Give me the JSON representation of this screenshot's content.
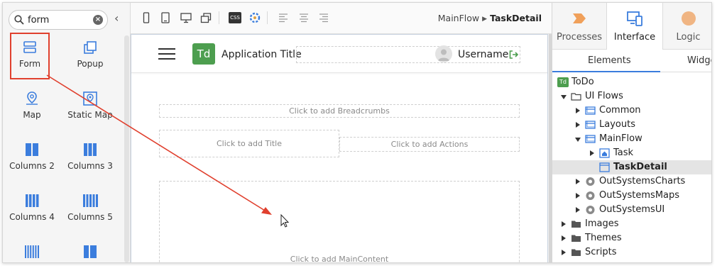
{
  "toolbox": {
    "search_value": "form",
    "items": [
      {
        "label": "Form",
        "icon": "form-icon",
        "selected": true
      },
      {
        "label": "Popup",
        "icon": "popup-icon"
      },
      {
        "label": "Map",
        "icon": "map-pin-icon"
      },
      {
        "label": "Static Map",
        "icon": "static-map-icon"
      },
      {
        "label": "Columns 2",
        "icon": "columns-2-icon"
      },
      {
        "label": "Columns 3",
        "icon": "columns-3-icon"
      },
      {
        "label": "Columns 4",
        "icon": "columns-4-icon"
      },
      {
        "label": "Columns 5",
        "icon": "columns-5-icon"
      }
    ]
  },
  "toolbar": {
    "css_label": "CSS",
    "breadcrumb_parent": "MainFlow",
    "breadcrumb_current": "TaskDetail"
  },
  "canvas": {
    "logo_text": "Td",
    "app_title": "Application Title",
    "username": "Username",
    "breadcrumbs_placeholder": "Click to add Breadcrumbs",
    "title_placeholder": "Click to add Title",
    "actions_placeholder": "Click to add Actions",
    "maincontent_placeholder": "Click to add MainContent"
  },
  "right_panel": {
    "tabs": [
      {
        "label": "Processes",
        "icon": "processes-icon"
      },
      {
        "label": "Interface",
        "icon": "interface-icon",
        "active": true
      },
      {
        "label": "Logic",
        "icon": "logic-icon"
      }
    ],
    "subtabs": [
      "Elements",
      "Widge"
    ],
    "tree": [
      {
        "label": "ToDo",
        "icon": "app-icon",
        "badge": "Td"
      },
      {
        "label": "UI Flows",
        "icon": "folder-open-icon"
      },
      {
        "label": "Common",
        "icon": "flow-icon"
      },
      {
        "label": "Layouts",
        "icon": "flow-icon"
      },
      {
        "label": "MainFlow",
        "icon": "flow-icon"
      },
      {
        "label": "Task",
        "icon": "home-screen-icon"
      },
      {
        "label": "TaskDetail",
        "icon": "screen-icon",
        "selected": true
      },
      {
        "label": "OutSystemsCharts",
        "icon": "module-reference-icon"
      },
      {
        "label": "OutSystemsMaps",
        "icon": "module-reference-icon"
      },
      {
        "label": "OutSystemsUI",
        "icon": "module-reference-icon"
      },
      {
        "label": "Images",
        "icon": "folder-icon"
      },
      {
        "label": "Themes",
        "icon": "folder-icon"
      },
      {
        "label": "Scripts",
        "icon": "folder-icon"
      }
    ]
  },
  "colors": {
    "accent_blue": "#3b7ddd",
    "selection_red": "#e0402e",
    "logo_green": "#4d9e4f",
    "processes_orange": "#f0a05a"
  }
}
